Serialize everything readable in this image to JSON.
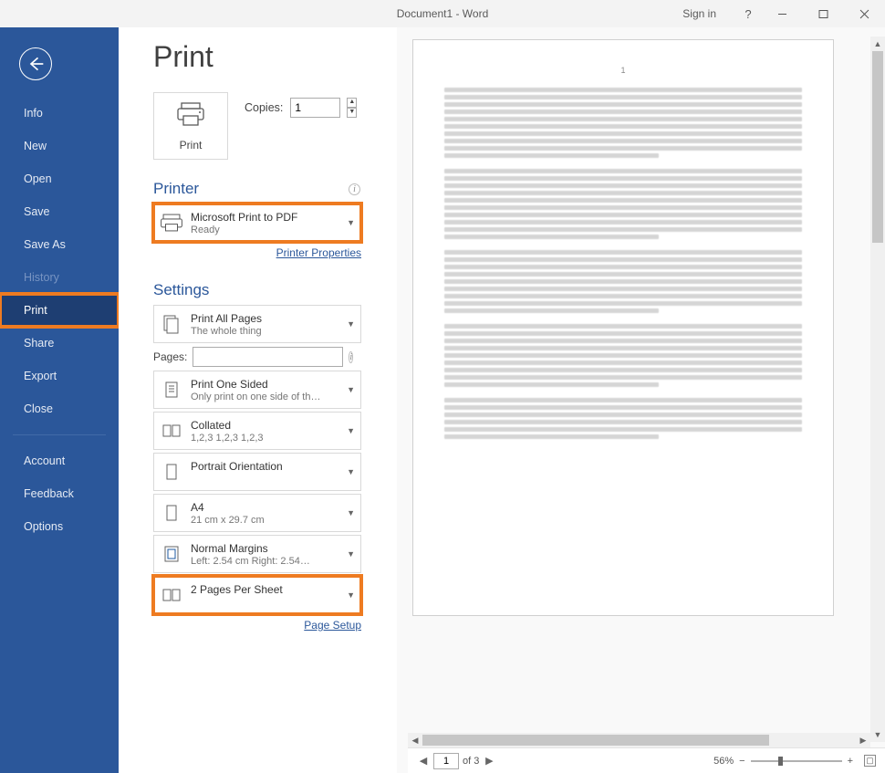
{
  "titlebar": {
    "title": "Document1 - Word",
    "signin": "Sign in"
  },
  "sidebar": {
    "items": [
      {
        "label": "Info"
      },
      {
        "label": "New"
      },
      {
        "label": "Open"
      },
      {
        "label": "Save"
      },
      {
        "label": "Save As"
      },
      {
        "label": "History"
      },
      {
        "label": "Print"
      },
      {
        "label": "Share"
      },
      {
        "label": "Export"
      },
      {
        "label": "Close"
      },
      {
        "label": "Account"
      },
      {
        "label": "Feedback"
      },
      {
        "label": "Options"
      }
    ]
  },
  "page": {
    "title": "Print"
  },
  "printbtn": {
    "label": "Print"
  },
  "copies": {
    "label": "Copies:",
    "value": "1"
  },
  "printer": {
    "section": "Printer",
    "name": "Microsoft Print to PDF",
    "status": "Ready",
    "props": "Printer Properties"
  },
  "settings": {
    "section": "Settings",
    "print_what": {
      "t1": "Print All Pages",
      "t2": "The whole thing"
    },
    "pages_label": "Pages:",
    "pages_value": "",
    "sided": {
      "t1": "Print One Sided",
      "t2": "Only print on one side of th…"
    },
    "collate": {
      "t1": "Collated",
      "t2": "1,2,3    1,2,3    1,2,3"
    },
    "orientation": {
      "t1": "Portrait Orientation"
    },
    "paper": {
      "t1": "A4",
      "t2": "21 cm x 29.7 cm"
    },
    "margins": {
      "t1": "Normal Margins",
      "t2": "Left:  2.54 cm    Right:  2.54…"
    },
    "per_sheet": {
      "t1": "2 Pages Per Sheet"
    },
    "page_setup": "Page Setup"
  },
  "preview": {
    "page_number": "1",
    "currentpage_input": "1",
    "of_pages": "of 3",
    "zoom": "56%"
  }
}
